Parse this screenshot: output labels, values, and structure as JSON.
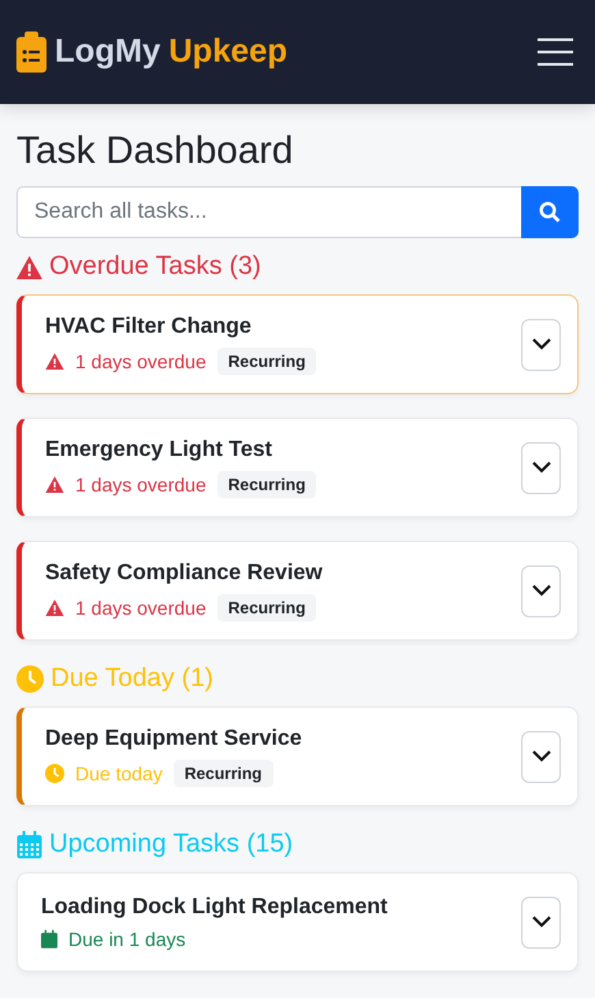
{
  "brand": {
    "first": "LogMy",
    "second": "Upkeep"
  },
  "page_title": "Task Dashboard",
  "search": {
    "placeholder": "Search all tasks..."
  },
  "sections": [
    {
      "kind": "overdue",
      "title": "Overdue Tasks (3)",
      "tasks": [
        {
          "name": "HVAC Filter Change",
          "status": "1 days overdue",
          "tag": "Recurring",
          "highlighted": true
        },
        {
          "name": "Emergency Light Test",
          "status": "1 days overdue",
          "tag": "Recurring",
          "highlighted": false
        },
        {
          "name": "Safety Compliance Review",
          "status": "1 days overdue",
          "tag": "Recurring",
          "highlighted": false
        }
      ]
    },
    {
      "kind": "today",
      "title": "Due Today (1)",
      "tasks": [
        {
          "name": "Deep Equipment Service",
          "status": "Due today",
          "tag": "Recurring",
          "highlighted": false
        }
      ]
    },
    {
      "kind": "upcoming",
      "title": "Upcoming Tasks (15)",
      "tasks": [
        {
          "name": "Loading Dock Light Replacement",
          "status": "Due in 1 days",
          "highlighted": false
        }
      ]
    }
  ]
}
